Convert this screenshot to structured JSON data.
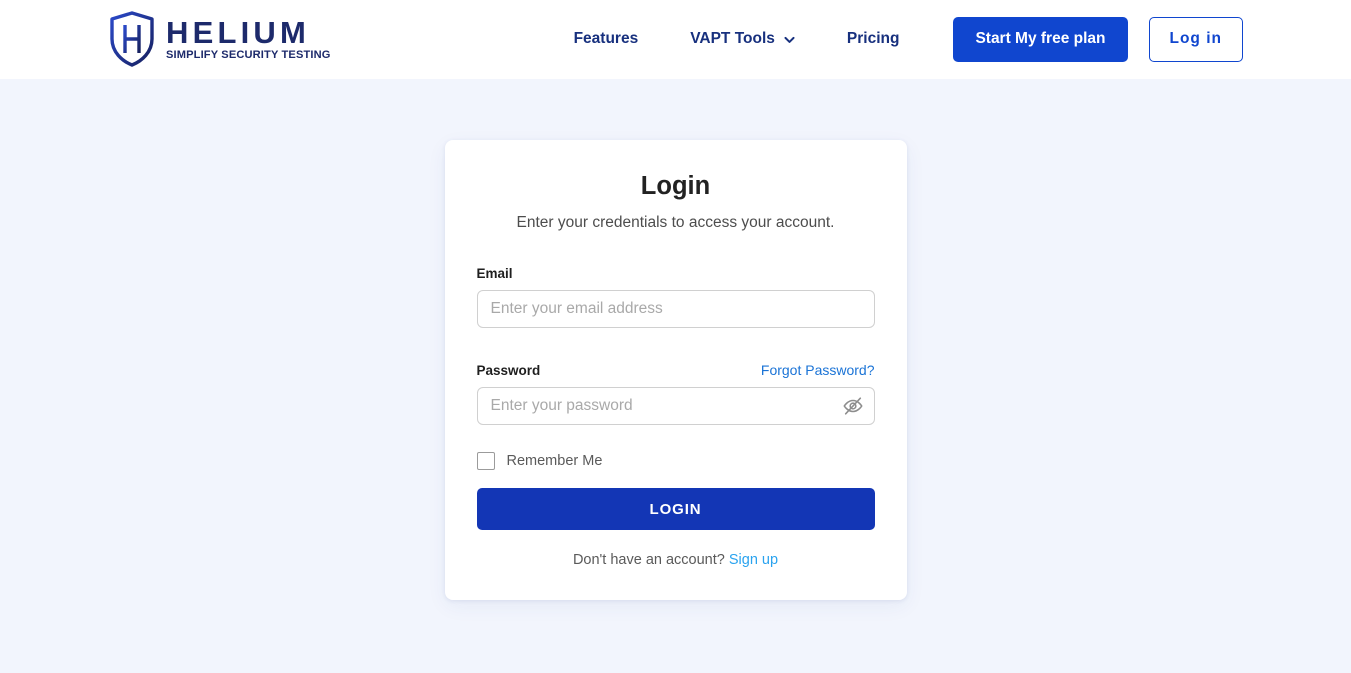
{
  "brand": {
    "name": "HELIUM",
    "tagline": "SIMPLIFY SECURITY TESTING",
    "logo_icon": "shield-h-logo-icon",
    "navy": "#1d2a6b",
    "blue": "#1046cf"
  },
  "nav": {
    "items": [
      {
        "label": "Features",
        "has_dropdown": false
      },
      {
        "label": "VAPT Tools",
        "has_dropdown": true,
        "icon": "chevron-down-icon"
      },
      {
        "label": "Pricing",
        "has_dropdown": false
      }
    ],
    "cta_primary": "Start My free plan",
    "cta_secondary": "Log in"
  },
  "login_card": {
    "title": "Login",
    "subtitle": "Enter your credentials to access your account.",
    "email": {
      "label": "Email",
      "placeholder": "Enter your email address",
      "value": ""
    },
    "password": {
      "label": "Password",
      "placeholder": "Enter your password",
      "value": "",
      "forgot_link": "Forgot Password?",
      "toggle_icon": "eye-off-icon"
    },
    "remember": {
      "label": "Remember Me",
      "checked": false
    },
    "submit_label": "LOGIN",
    "signup_prompt": "Don't have an account?",
    "signup_link": "Sign up",
    "accent_button": "#1336b5",
    "link_blue": "#1a73d6",
    "signup_blue": "#2aa3ef"
  },
  "page": {
    "background": "#f2f5fd"
  }
}
